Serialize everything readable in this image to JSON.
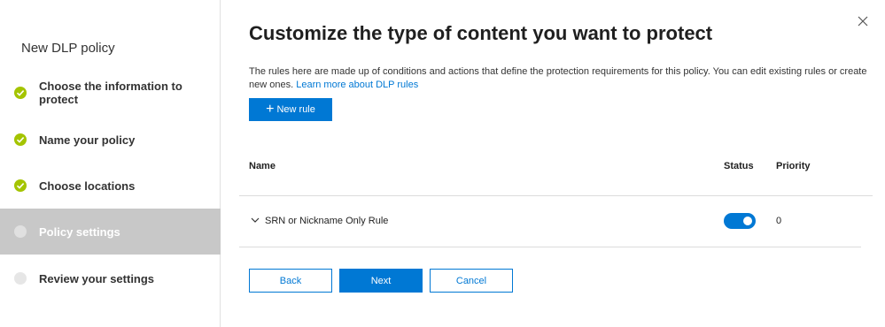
{
  "sidebar": {
    "title": "New DLP policy",
    "steps": [
      {
        "label": "Choose the information to protect",
        "status": "done"
      },
      {
        "label": "Name your policy",
        "status": "done"
      },
      {
        "label": "Choose locations",
        "status": "done"
      },
      {
        "label": "Policy settings",
        "status": "current"
      },
      {
        "label": "Review your settings",
        "status": "pending"
      }
    ]
  },
  "main": {
    "title": "Customize the type of content you want to protect",
    "description": "The rules here are made up of conditions and actions that define the protection requirements for this policy. You can edit existing rules or create new ones.",
    "learn_more": "Learn more about DLP rules",
    "new_rule_label": "New rule",
    "table": {
      "headers": {
        "name": "Name",
        "status": "Status",
        "priority": "Priority"
      },
      "rows": [
        {
          "name": "SRN or Nickname Only Rule",
          "status_on": true,
          "priority": "0"
        }
      ]
    },
    "footer": {
      "back": "Back",
      "next": "Next",
      "cancel": "Cancel"
    }
  },
  "colors": {
    "accent": "#0078d4",
    "done": "#a4c400",
    "active_step_bg": "#c8c8c8"
  },
  "icons": {
    "close": "close-icon",
    "check": "checkmark-icon",
    "plus": "plus-icon",
    "chevron": "chevron-down-icon"
  }
}
